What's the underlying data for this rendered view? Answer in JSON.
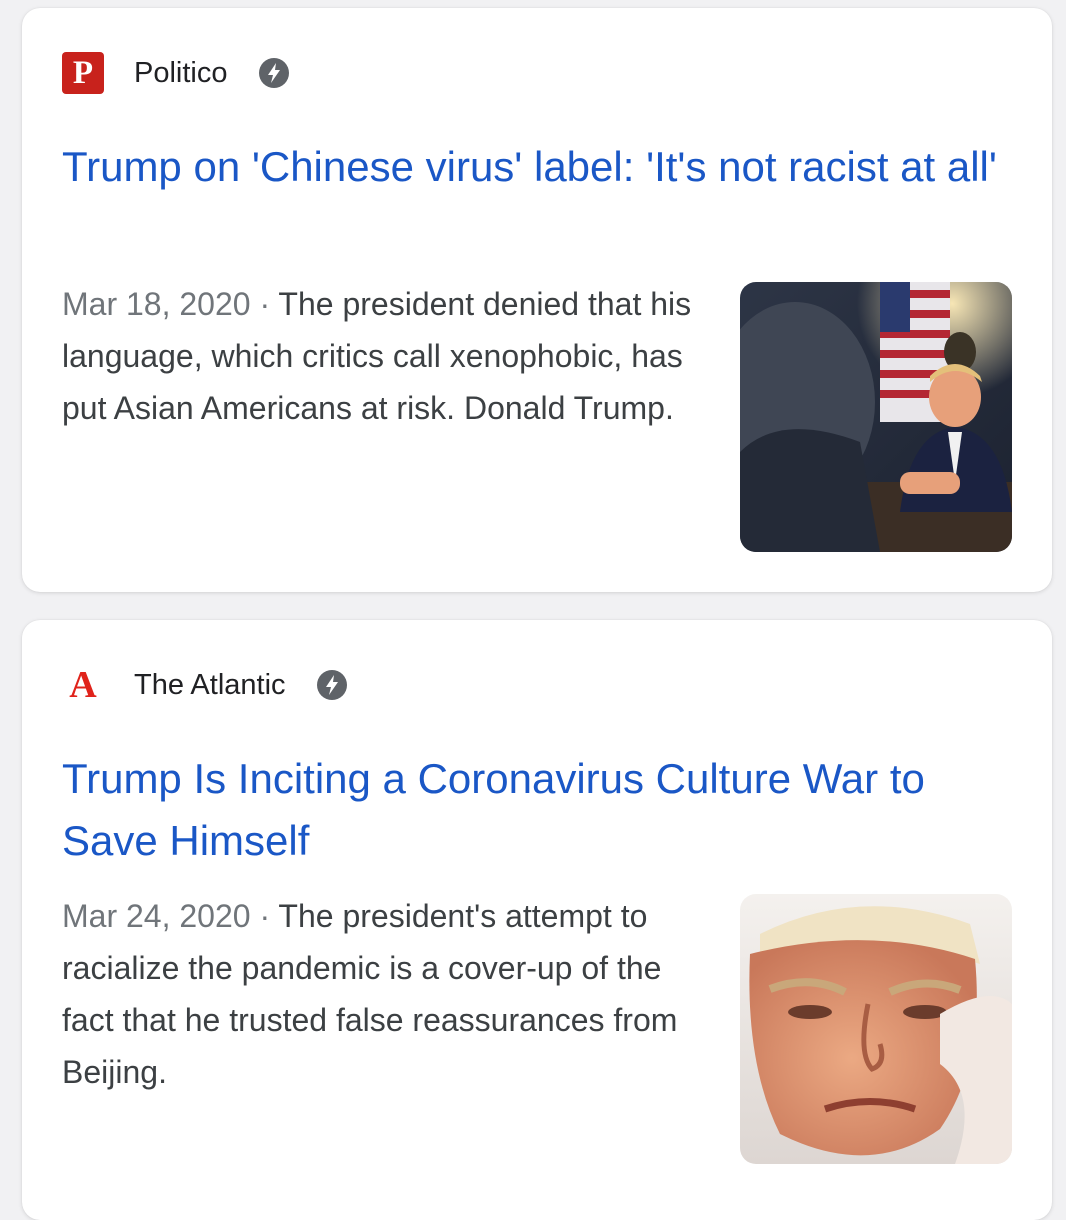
{
  "results": [
    {
      "source": "Politico",
      "logo_letter": "P",
      "amp_icon": "amp-bolt-icon",
      "headline": "Trump on 'Chinese virus' label: 'It's not racist at all'",
      "date": "Mar 18, 2020",
      "separator": "·",
      "snippet": "The president denied that his language, which critics call xenophobic, has put Asian Americans at risk. Donald Trump.",
      "thumbnail": "photo-trump-at-table-with-flags"
    },
    {
      "source": "The Atlantic",
      "logo_letter": "A",
      "amp_icon": "amp-bolt-icon",
      "headline": "Trump Is Inciting a Coronavirus Culture War to Save Himself",
      "date": "Mar 24, 2020",
      "separator": "·",
      "snippet": "The president's attempt to racialize the pandemic is a cover-up of the fact that he trusted false reassurances from Beijing.",
      "thumbnail": "photo-trump-closeup"
    }
  ],
  "colors": {
    "link": "#1a57c6",
    "politico_brand": "#c8221c",
    "atlantic_brand": "#e0231b",
    "date": "#70757a",
    "snippet": "#3c4043"
  }
}
